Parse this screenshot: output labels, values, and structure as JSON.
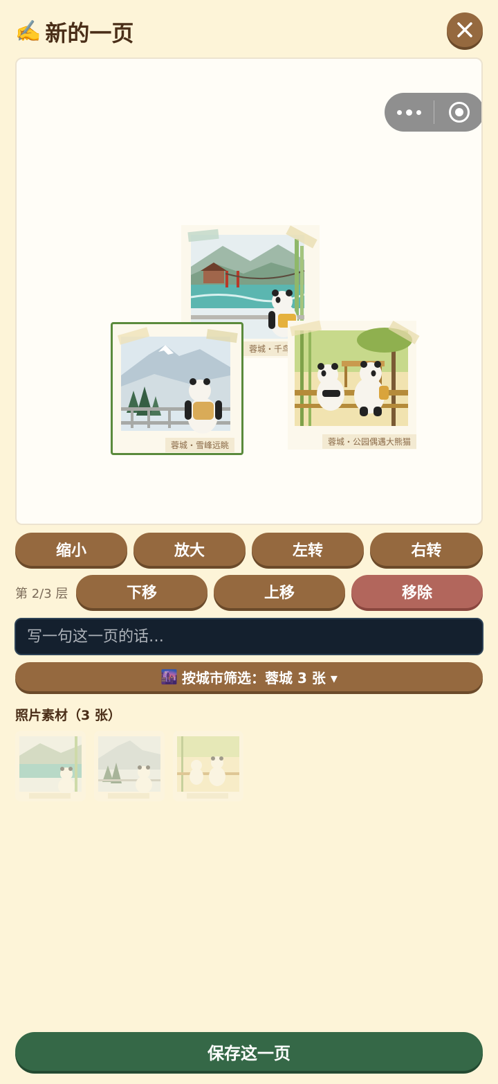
{
  "header": {
    "icon": "✍️",
    "title": "新的一页",
    "close_icon": "close-icon"
  },
  "capsule": {
    "more_icon": "more-dots-icon",
    "target_icon": "record-target-icon"
  },
  "canvas": {
    "photos": [
      {
        "caption": "蓉城・千鸟",
        "scene": "river-bridge-panda"
      },
      {
        "caption": "蓉城・雪峰远眺",
        "scene": "snow-mountain-panda",
        "selected": true
      },
      {
        "caption": "蓉城・公园偶遇大熊猫",
        "scene": "bamboo-park-pandas"
      }
    ]
  },
  "controls": {
    "shrink": "缩小",
    "enlarge": "放大",
    "rotate_left": "左转",
    "rotate_right": "右转",
    "layer_label": "第 2/3 层",
    "move_down": "下移",
    "move_up": "上移",
    "remove": "移除"
  },
  "caption_input": {
    "placeholder": "写一句这一页的话…",
    "value": ""
  },
  "city_filter": {
    "icon": "🌆",
    "label": "按城市筛选：蓉城 3 张 ▾"
  },
  "materials": {
    "title": "照片素材（3 张）",
    "thumbs": [
      "蓉城・千鸟",
      "蓉城・雪峰远眺",
      "蓉城・公园偶遇大熊猫"
    ]
  },
  "save_label": "保存这一页",
  "colors": {
    "background": "#fdf4d8",
    "brown_button": "#95693f",
    "remove_button": "#b2665c",
    "save_button": "#356847",
    "input_bg": "#14202e",
    "selected_border": "#5a8a3c"
  }
}
